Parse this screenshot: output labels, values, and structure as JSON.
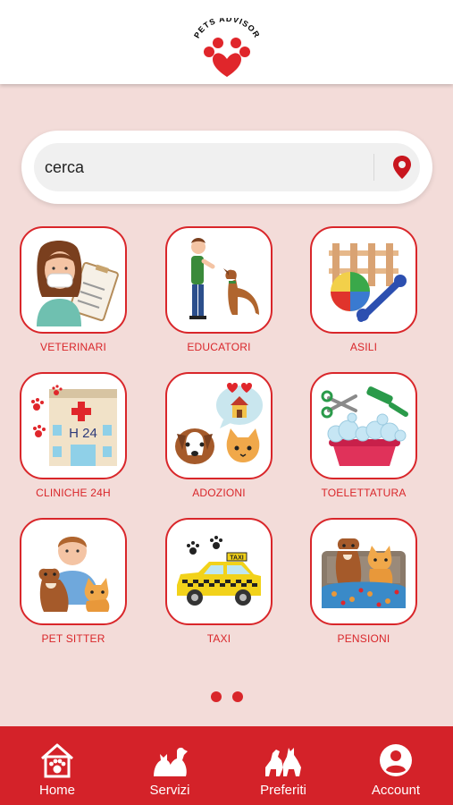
{
  "header": {
    "logo_text": "PETS ADVISOR"
  },
  "search": {
    "placeholder": "cerca",
    "value": ""
  },
  "categories": [
    {
      "label": "VETERINARI"
    },
    {
      "label": "EDUCATORI"
    },
    {
      "label": "ASILI"
    },
    {
      "label": "CLINICHE 24H"
    },
    {
      "label": "ADOZIONI"
    },
    {
      "label": "TOELETTATURA"
    },
    {
      "label": "PET SITTER"
    },
    {
      "label": "TAXI"
    },
    {
      "label": "PENSIONI"
    }
  ],
  "icon_texts": {
    "clinic_sign": "H 24",
    "taxi_sign": "TAXI"
  },
  "pager": {
    "pages": 2
  },
  "tabbar": {
    "items": [
      {
        "label": "Home",
        "icon": "house-paw-icon"
      },
      {
        "label": "Servizi",
        "icon": "dog-cat-icon"
      },
      {
        "label": "Preferiti",
        "icon": "dog-cat-play-icon"
      },
      {
        "label": "Account",
        "icon": "account-icon"
      }
    ]
  },
  "colors": {
    "accent": "#d9262a",
    "background": "#f3dcd9",
    "tabbar": "#d42229"
  }
}
